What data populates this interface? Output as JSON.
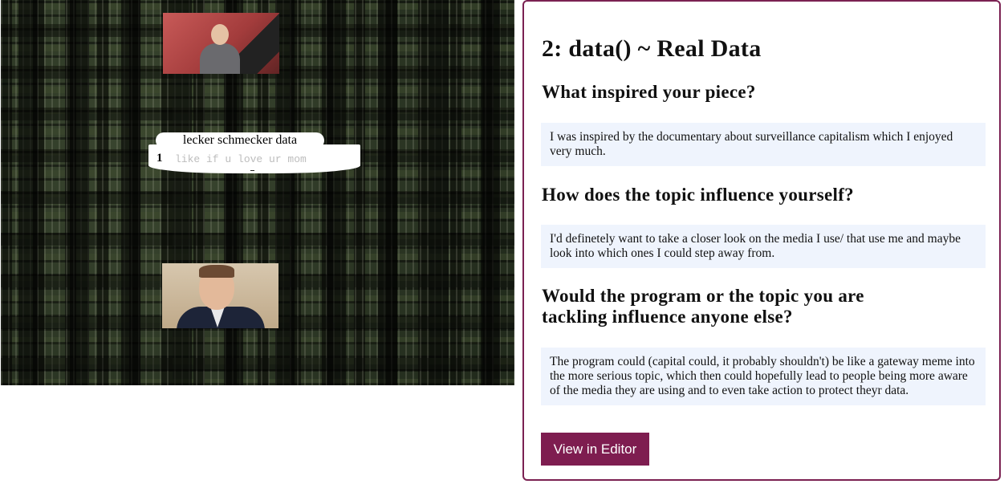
{
  "sketch": {
    "title": "lecker schmecker data",
    "code_line_number": "1",
    "code_text": "like if u love ur mom"
  },
  "panel": {
    "title": "2: data() ~ Real Data",
    "questions": [
      {
        "question": "What inspired your piece?",
        "answer": "I was inspired by the documentary about surveillance capitalism which I enjoyed very much."
      },
      {
        "question": "How does the topic influence yourself?",
        "answer": "I'd definetely want to take a closer look on the media I use/ that use me and maybe look into which ones I could step away from."
      },
      {
        "question": "Would the program or the topic you are tackling influence anyone else?",
        "answer": "The program could (capital could, it probably shouldn't) be like a gateway meme into the more serious topic, which then could hopefully lead to people being more aware of the media they are using and to even take action to protect theyr data."
      }
    ],
    "editor_button_label": "View in Editor"
  },
  "colors": {
    "panel_border": "#7b2152",
    "button_bg": "#7e1d50",
    "answer_bg": "#eff4fd"
  }
}
